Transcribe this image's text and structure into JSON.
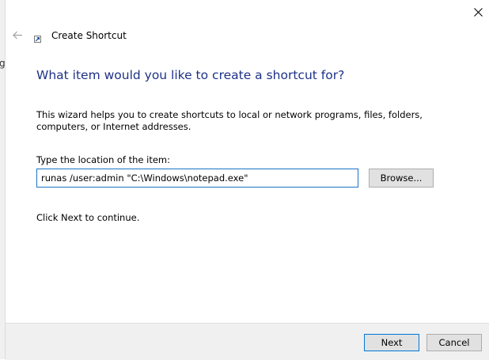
{
  "background_fragment": "g",
  "window": {
    "title": "Create Shortcut",
    "close_icon": "close-icon",
    "back_icon": "back-arrow-icon",
    "title_icon": "shortcut-icon"
  },
  "content": {
    "heading": "What item would you like to create a shortcut for?",
    "description": "This wizard helps you to create shortcuts to local or network programs, files, folders, computers, or Internet addresses.",
    "location_label": "Type the location of the item:",
    "location_value": "runas /user:admin \"C:\\Windows\\notepad.exe\"",
    "browse_label": "Browse...",
    "continue_text": "Click Next to continue."
  },
  "footer": {
    "next_label": "Next",
    "cancel_label": "Cancel"
  },
  "colors": {
    "heading": "#1e3287",
    "focus_border": "#1a73c7",
    "button_bg": "#e1e1e1",
    "footer_bg": "#f0f0f0"
  }
}
